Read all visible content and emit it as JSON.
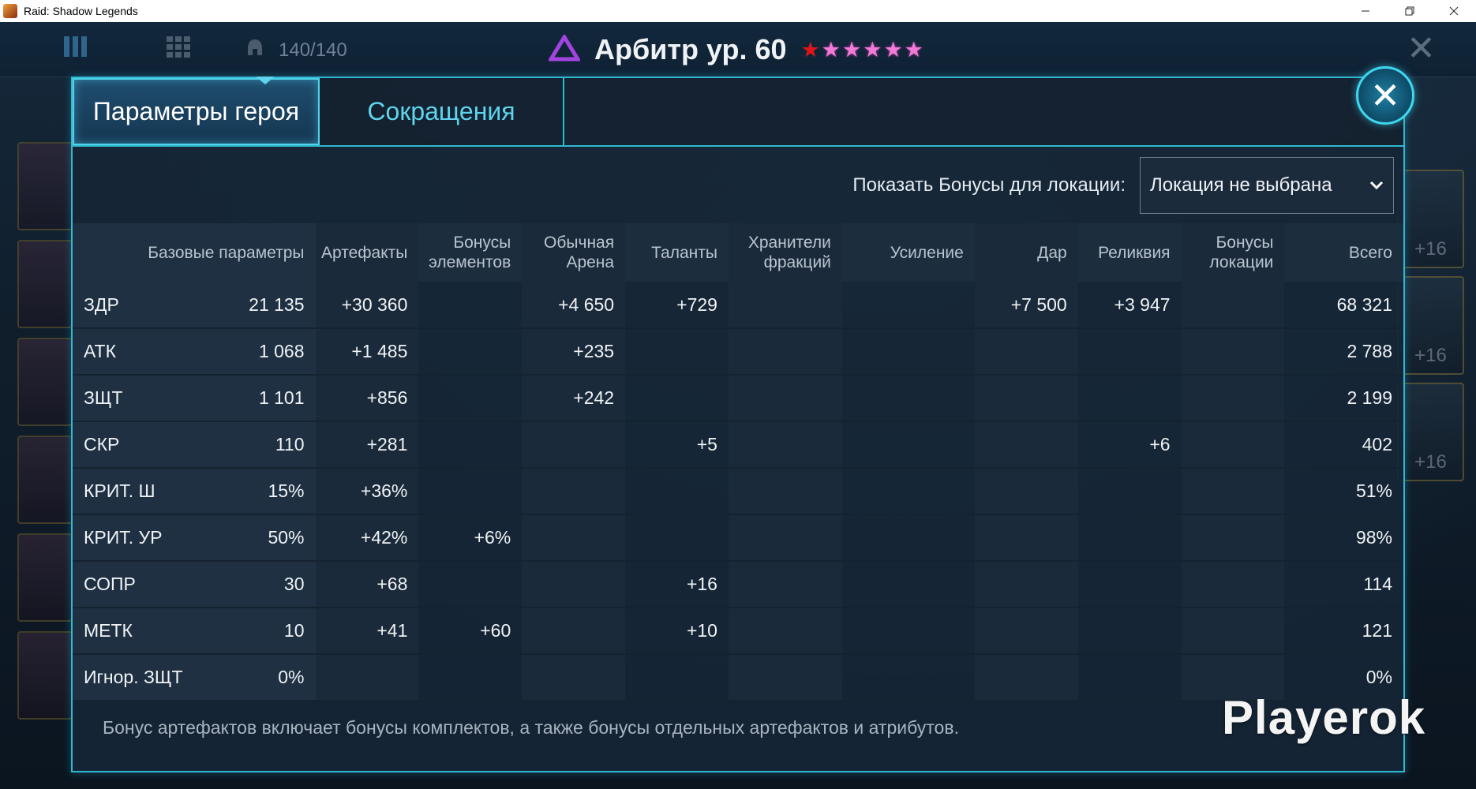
{
  "window": {
    "title": "Raid: Shadow Legends"
  },
  "topbar": {
    "hero_count": "140/140"
  },
  "hero": {
    "title": "Арбитр ур. 60",
    "stars_red": 1,
    "stars_pink": 5
  },
  "tabs": [
    {
      "label": "Параметры героя",
      "active": true
    },
    {
      "label": "Сокращения",
      "active": false
    }
  ],
  "location": {
    "label": "Показать Бонусы для локации:",
    "selected": "Локация не выбрана"
  },
  "side_labels": {
    "plus16": "+16"
  },
  "columns": [
    "Базовые параметры",
    "Артефакты",
    "Бонусы элементов",
    "Обычная Арена",
    "Таланты",
    "Хранители фракций",
    "Усиление",
    "Дар",
    "Реликвия",
    "Бонусы локации",
    "Всего"
  ],
  "rows": [
    {
      "stat": "ЗДР",
      "base": "21 135",
      "artifacts": "+30 360",
      "elements": "",
      "arena": "+4 650",
      "talents": "+729",
      "keepers": "",
      "boost": "",
      "gift": "+7 500",
      "relic": "+3 947",
      "location": "",
      "total": "68 321"
    },
    {
      "stat": "АТК",
      "base": "1 068",
      "artifacts": "+1 485",
      "elements": "",
      "arena": "+235",
      "talents": "",
      "keepers": "",
      "boost": "",
      "gift": "",
      "relic": "",
      "location": "",
      "total": "2 788"
    },
    {
      "stat": "ЗЩТ",
      "base": "1 101",
      "artifacts": "+856",
      "elements": "",
      "arena": "+242",
      "talents": "",
      "keepers": "",
      "boost": "",
      "gift": "",
      "relic": "",
      "location": "",
      "total": "2 199"
    },
    {
      "stat": "СКР",
      "base": "110",
      "artifacts": "+281",
      "elements": "",
      "arena": "",
      "talents": "+5",
      "keepers": "",
      "boost": "",
      "gift": "",
      "relic": "+6",
      "location": "",
      "total": "402"
    },
    {
      "stat": "КРИТ. Ш",
      "base": "15%",
      "artifacts": "+36%",
      "elements": "",
      "arena": "",
      "talents": "",
      "keepers": "",
      "boost": "",
      "gift": "",
      "relic": "",
      "location": "",
      "total": "51%"
    },
    {
      "stat": "КРИТ. УР",
      "base": "50%",
      "artifacts": "+42%",
      "elements": "+6%",
      "arena": "",
      "talents": "",
      "keepers": "",
      "boost": "",
      "gift": "",
      "relic": "",
      "location": "",
      "total": "98%"
    },
    {
      "stat": "СОПР",
      "base": "30",
      "artifacts": "+68",
      "elements": "",
      "arena": "",
      "talents": "+16",
      "keepers": "",
      "boost": "",
      "gift": "",
      "relic": "",
      "location": "",
      "total": "114"
    },
    {
      "stat": "МЕТК",
      "base": "10",
      "artifacts": "+41",
      "elements": "+60",
      "arena": "",
      "talents": "+10",
      "keepers": "",
      "boost": "",
      "gift": "",
      "relic": "",
      "location": "",
      "total": "121"
    },
    {
      "stat": "Игнор. ЗЩТ",
      "base": "0%",
      "artifacts": "",
      "elements": "",
      "arena": "",
      "talents": "",
      "keepers": "",
      "boost": "",
      "gift": "",
      "relic": "",
      "location": "",
      "total": "0%"
    }
  ],
  "footnote": "Бонус артефактов включает бонусы комплектов, а также бонусы отдельных артефактов и атрибутов.",
  "watermark": "Playerok",
  "colors": {
    "accent": "#2fb8d0",
    "positive": "#3cd63c",
    "total": "#f1e27a"
  }
}
